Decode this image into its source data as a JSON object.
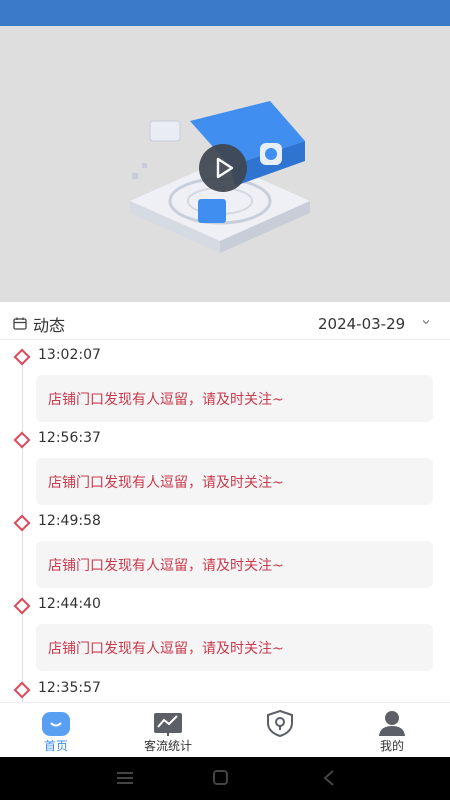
{
  "dynamics": {
    "title": "动态",
    "date": "2024-03-29"
  },
  "entries": [
    {
      "time": "13:02:07",
      "message": "店铺门口发现有人逗留，请及时关注~"
    },
    {
      "time": "12:56:37",
      "message": "店铺门口发现有人逗留，请及时关注~"
    },
    {
      "time": "12:49:58",
      "message": "店铺门口发现有人逗留，请及时关注~"
    },
    {
      "time": "12:44:40",
      "message": "店铺门口发现有人逗留，请及时关注~"
    },
    {
      "time": "12:35:57",
      "message": ""
    }
  ],
  "tabs": [
    {
      "label": "首页",
      "icon": "home-icon",
      "active": true
    },
    {
      "label": "客流统计",
      "icon": "chart-icon",
      "active": false
    },
    {
      "label": "",
      "icon": "shield-icon",
      "active": false
    },
    {
      "label": "我的",
      "icon": "profile-icon",
      "active": false
    }
  ],
  "colors": {
    "accent": "#3f8ef0",
    "alert": "#c93a4d",
    "marker": "#e0485a",
    "status_bar": "#3a7ac8"
  }
}
